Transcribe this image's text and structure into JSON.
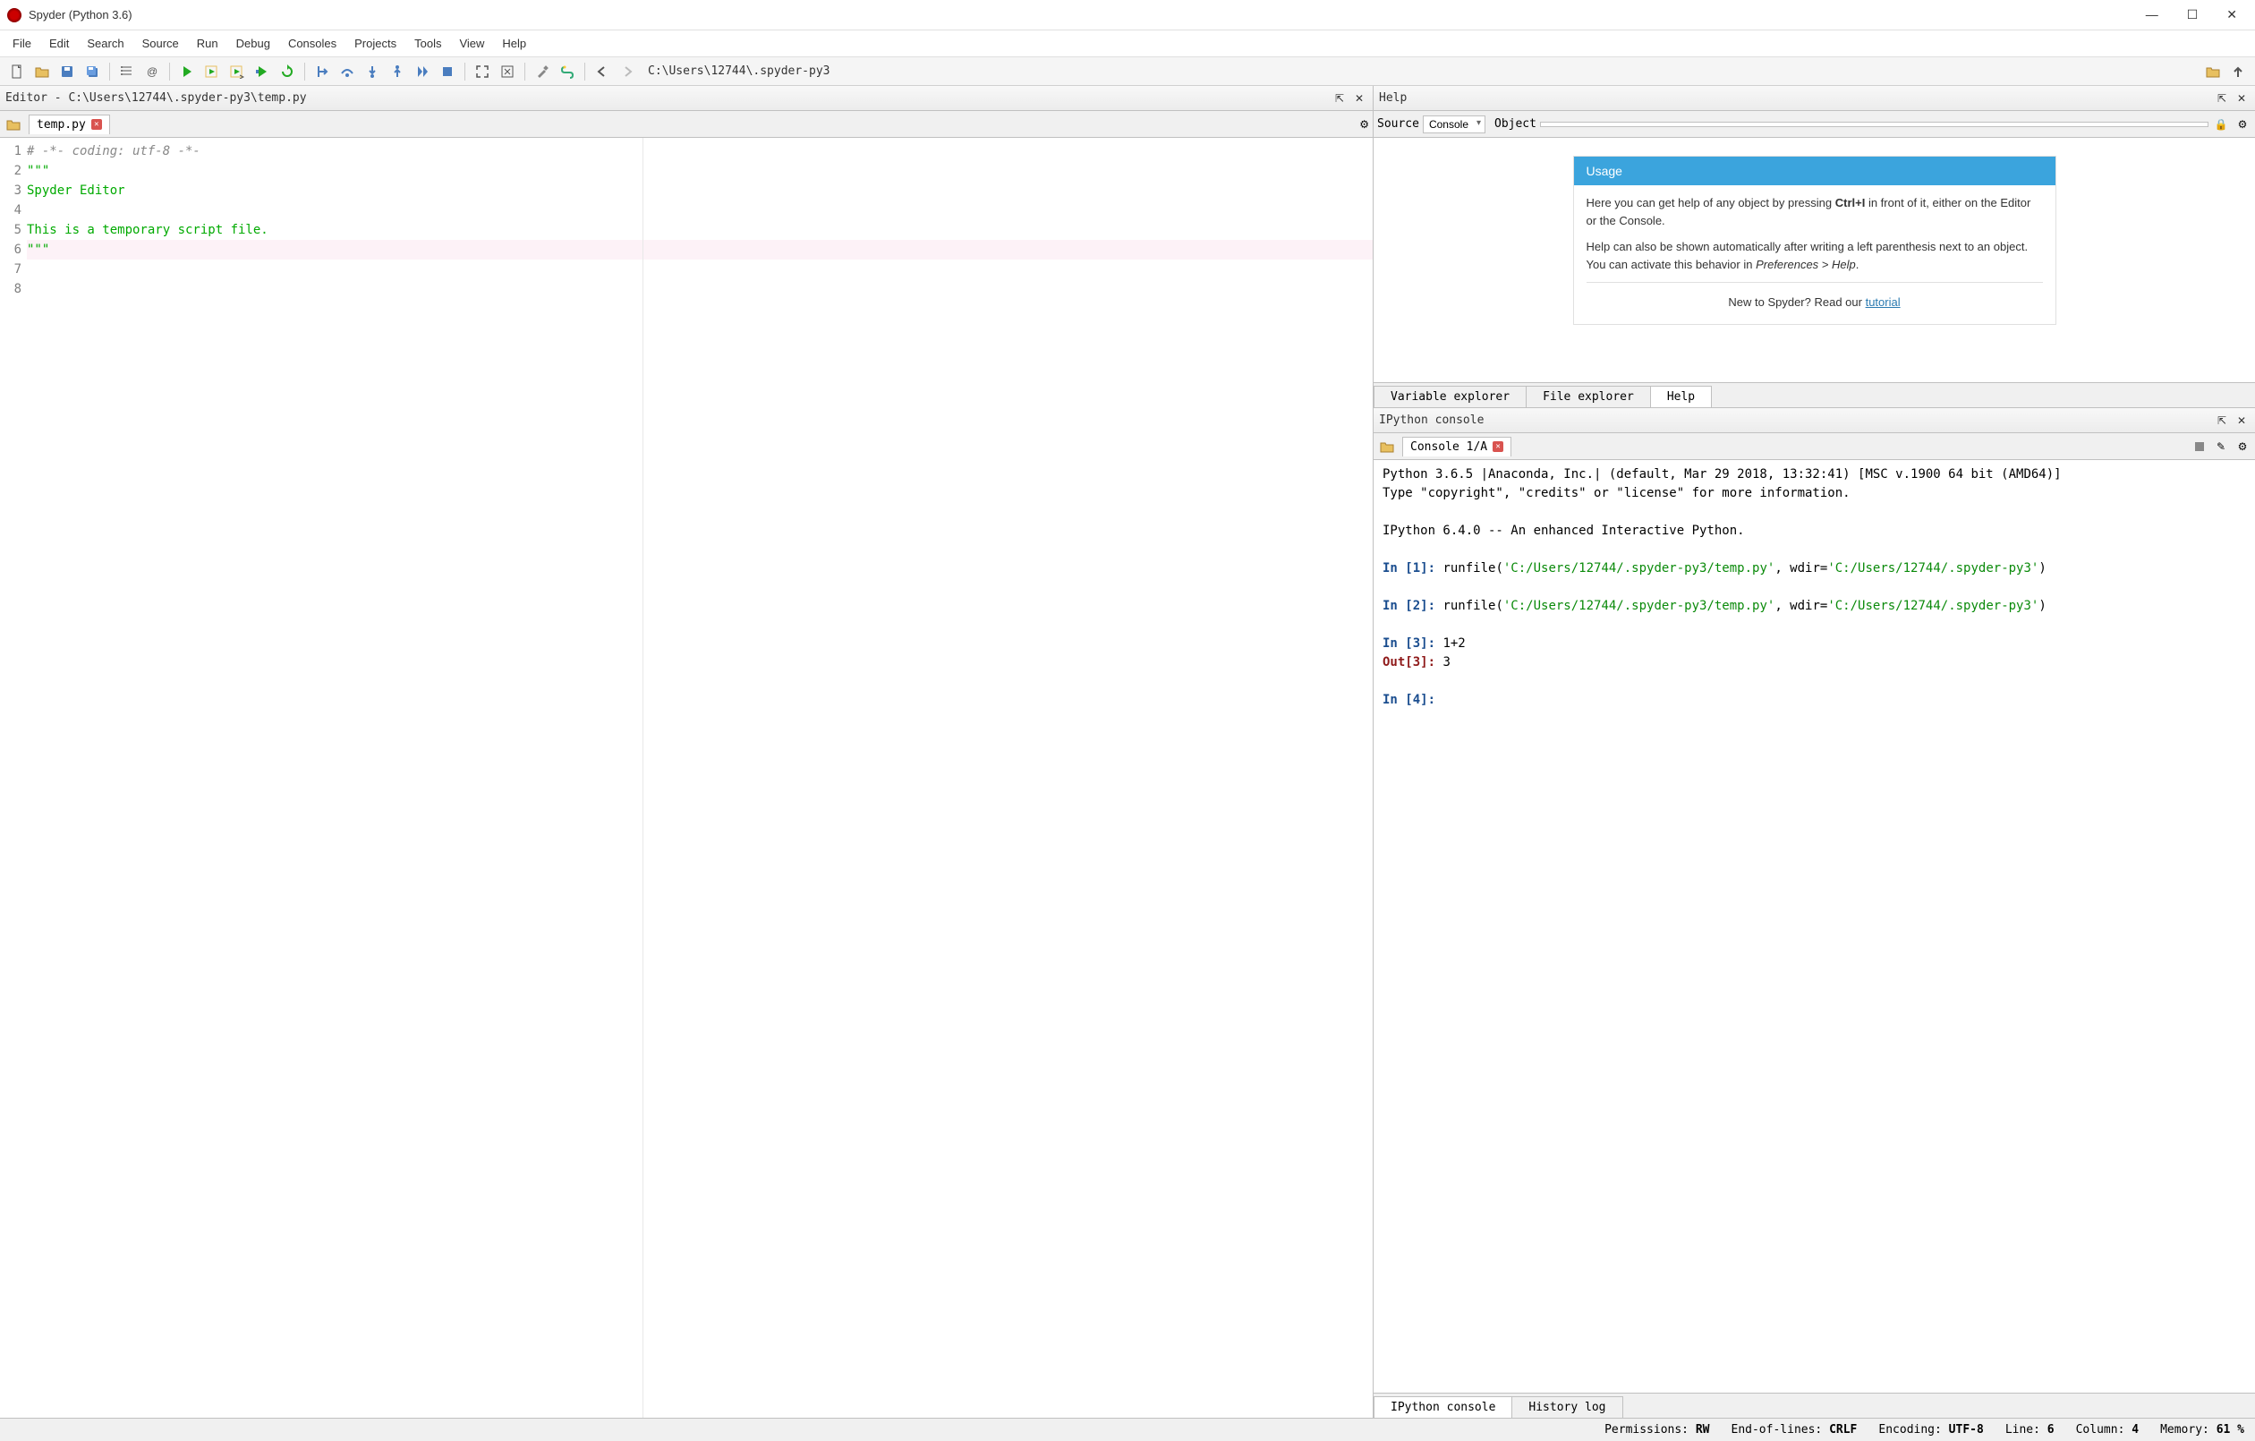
{
  "window": {
    "title": "Spyder (Python 3.6)"
  },
  "menu": [
    "File",
    "Edit",
    "Search",
    "Source",
    "Run",
    "Debug",
    "Consoles",
    "Projects",
    "Tools",
    "View",
    "Help"
  ],
  "toolbar": {
    "path": "C:\\Users\\12744\\.spyder-py3"
  },
  "editor": {
    "header": "Editor - C:\\Users\\12744\\.spyder-py3\\temp.py",
    "tab": "temp.py",
    "lines": [
      {
        "n": 1,
        "cls": "c-comment",
        "text": "# -*- coding: utf-8 -*-"
      },
      {
        "n": 2,
        "cls": "c-string",
        "text": "\"\"\""
      },
      {
        "n": 3,
        "cls": "c-string",
        "text": "Spyder Editor"
      },
      {
        "n": 4,
        "cls": "c-string",
        "text": ""
      },
      {
        "n": 5,
        "cls": "c-string",
        "text": "This is a temporary script file."
      },
      {
        "n": 6,
        "cls": "c-string hl-line",
        "text": "\"\"\""
      },
      {
        "n": 7,
        "cls": "",
        "text": ""
      },
      {
        "n": 8,
        "cls": "",
        "text": ""
      }
    ]
  },
  "help": {
    "header": "Help",
    "source_label": "Source",
    "source_value": "Console",
    "object_label": "Object",
    "usage_title": "Usage",
    "usage_p1_a": "Here you can get help of any object by pressing ",
    "usage_p1_b": "Ctrl+I",
    "usage_p1_c": " in front of it, either on the Editor or the Console.",
    "usage_p2_a": "Help can also be shown automatically after writing a left parenthesis next to an object. You can activate this behavior in ",
    "usage_p2_b": "Preferences > Help",
    "usage_p2_c": ".",
    "tutorial_a": "New to Spyder? Read our ",
    "tutorial_link": "tutorial",
    "tabs": [
      "Variable explorer",
      "File explorer",
      "Help"
    ],
    "active_tab": 2
  },
  "console": {
    "header": "IPython console",
    "tab": "Console 1/A",
    "banner1": "Python 3.6.5 |Anaconda, Inc.| (default, Mar 29 2018, 13:32:41) [MSC v.1900 64 bit (AMD64)]",
    "banner2": "Type \"copyright\", \"credits\" or \"license\" for more information.",
    "banner3": "IPython 6.4.0 -- An enhanced Interactive Python.",
    "entries": [
      {
        "in_n": 1,
        "code_pre": "runfile(",
        "str1": "'C:/Users/12744/.spyder-py3/temp.py'",
        "mid": ", wdir=",
        "str2": "'C:/Users/12744/.spyder-py3'",
        "post": ")"
      },
      {
        "in_n": 2,
        "code_pre": "runfile(",
        "str1": "'C:/Users/12744/.spyder-py3/temp.py'",
        "mid": ", wdir=",
        "str2": "'C:/Users/12744/.spyder-py3'",
        "post": ")"
      },
      {
        "in_n": 3,
        "plain": "1+2",
        "out": "3"
      },
      {
        "in_n": 4,
        "plain": ""
      }
    ],
    "bottom_tabs": [
      "IPython console",
      "History log"
    ],
    "active_bottom": 0
  },
  "status": {
    "permissions_label": "Permissions:",
    "permissions": "RW",
    "eol_label": "End-of-lines:",
    "eol": "CRLF",
    "encoding_label": "Encoding:",
    "encoding": "UTF-8",
    "line_label": "Line:",
    "line": "6",
    "col_label": "Column:",
    "col": "4",
    "mem_label": "Memory:",
    "mem": "61 %"
  }
}
